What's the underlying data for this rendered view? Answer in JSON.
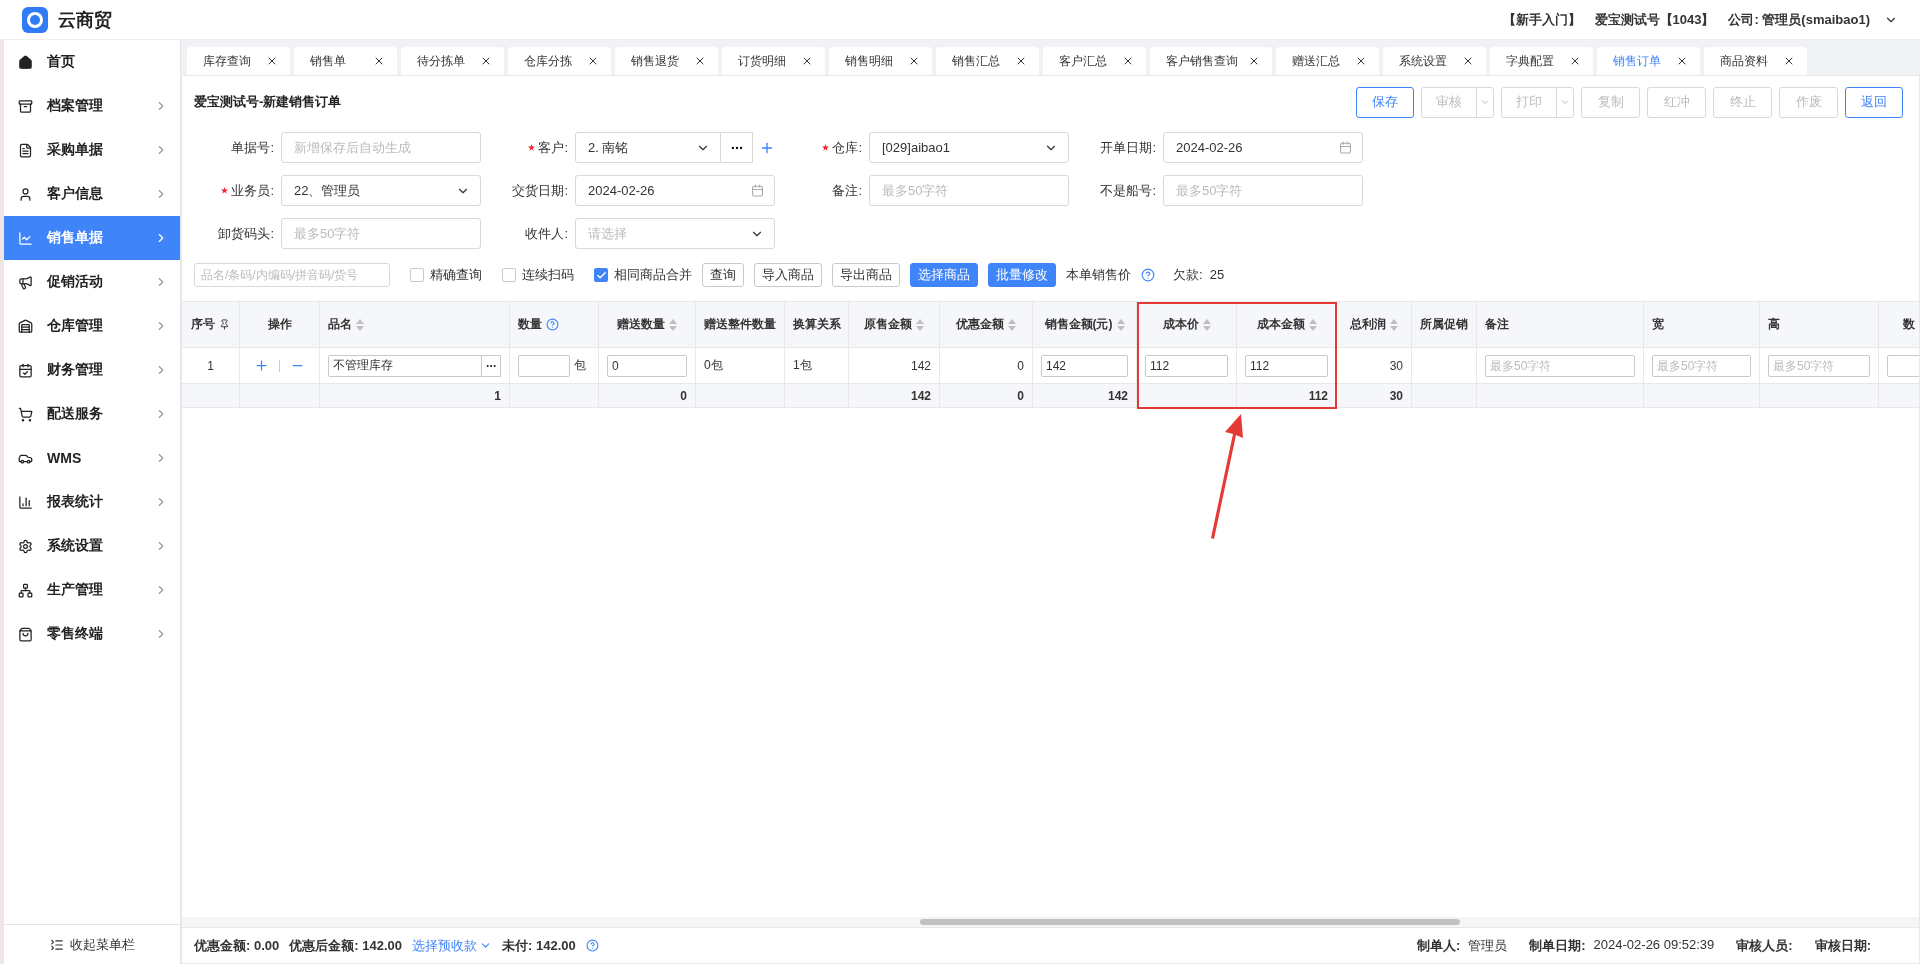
{
  "header": {
    "app_name": "云商贸",
    "links": [
      "【新手入门】",
      "爱宝测试号【1043】"
    ],
    "account": "公司: 管理员(smaibao1)"
  },
  "sidebar": {
    "items": [
      {
        "label": "首页",
        "selected": false,
        "expandable": false
      },
      {
        "label": "档案管理",
        "selected": false,
        "expandable": true
      },
      {
        "label": "采购单据",
        "selected": false,
        "expandable": true
      },
      {
        "label": "客户信息",
        "selected": false,
        "expandable": true
      },
      {
        "label": "销售单据",
        "selected": true,
        "expandable": true
      },
      {
        "label": "促销活动",
        "selected": false,
        "expandable": true
      },
      {
        "label": "仓库管理",
        "selected": false,
        "expandable": true
      },
      {
        "label": "财务管理",
        "selected": false,
        "expandable": true
      },
      {
        "label": "配送服务",
        "selected": false,
        "expandable": true
      },
      {
        "label": "WMS",
        "selected": false,
        "expandable": true
      },
      {
        "label": "报表统计",
        "selected": false,
        "expandable": true
      },
      {
        "label": "系统设置",
        "selected": false,
        "expandable": true
      },
      {
        "label": "生产管理",
        "selected": false,
        "expandable": true
      },
      {
        "label": "零售终端",
        "selected": false,
        "expandable": true
      }
    ],
    "collapse_label": "收起菜单栏"
  },
  "tabs": [
    {
      "label": "库存查询",
      "selected": false
    },
    {
      "label": "销售单",
      "selected": false
    },
    {
      "label": "待分拣单",
      "selected": false
    },
    {
      "label": "仓库分拣",
      "selected": false
    },
    {
      "label": "销售退货",
      "selected": false
    },
    {
      "label": "订货明细",
      "selected": false
    },
    {
      "label": "销售明细",
      "selected": false
    },
    {
      "label": "销售汇总",
      "selected": false
    },
    {
      "label": "客户汇总",
      "selected": false
    },
    {
      "label": "客户销售查询",
      "selected": false
    },
    {
      "label": "赠送汇总",
      "selected": false
    },
    {
      "label": "系统设置",
      "selected": false
    },
    {
      "label": "字典配置",
      "selected": false
    },
    {
      "label": "销售订单",
      "selected": true
    },
    {
      "label": "商品资料",
      "selected": false
    }
  ],
  "page_title": "爱宝测试号-新建销售订单",
  "actions": [
    {
      "label": "保存",
      "disabled": false,
      "dropdown": false
    },
    {
      "label": "审核",
      "disabled": true,
      "dropdown": true
    },
    {
      "label": "打印",
      "disabled": true,
      "dropdown": true
    },
    {
      "label": "复制",
      "disabled": true,
      "dropdown": false
    },
    {
      "label": "红冲",
      "disabled": true,
      "dropdown": false
    },
    {
      "label": "终止",
      "disabled": true,
      "dropdown": false
    },
    {
      "label": "作废",
      "disabled": true,
      "dropdown": false
    },
    {
      "label": "返回",
      "disabled": false,
      "dropdown": false
    }
  ],
  "form": [
    {
      "label": "单据号:",
      "required": false,
      "kind": "text",
      "placeholder": "新增保存后自动生成"
    },
    {
      "label": "客户:",
      "required": true,
      "kind": "customer",
      "value": "2. 南铭"
    },
    {
      "label": "仓库:",
      "required": true,
      "kind": "select",
      "value": "[029]aibao1"
    },
    {
      "label": "开单日期:",
      "required": false,
      "kind": "date",
      "value": "2024-02-26"
    },
    {
      "label": "业务员:",
      "required": true,
      "kind": "select",
      "value": "22、管理员"
    },
    {
      "label": "交货日期:",
      "required": false,
      "kind": "date",
      "value": "2024-02-26"
    },
    {
      "label": "备注:",
      "required": false,
      "kind": "text",
      "placeholder": "最多50字符"
    },
    {
      "label": "不是船号:",
      "required": false,
      "kind": "text",
      "placeholder": "最多50字符"
    },
    {
      "label": "卸货码头:",
      "required": false,
      "kind": "text",
      "placeholder": "最多50字符"
    },
    {
      "label": "收件人:",
      "required": false,
      "kind": "select",
      "placeholder": "请选择"
    }
  ],
  "toolbar": {
    "search": {
      "placeholder": "品名/条码/内编码/拼音码/货号"
    },
    "checkboxes": [
      {
        "label": "精确查询",
        "checked": false
      },
      {
        "label": "连续扫码",
        "checked": false
      },
      {
        "label": "相同商品合并",
        "checked": true
      }
    ],
    "buttons": [
      {
        "label": "查询",
        "kind": "default"
      },
      {
        "label": "导入商品",
        "kind": "default"
      },
      {
        "label": "导出商品",
        "kind": "default"
      },
      {
        "label": "选择商品",
        "kind": "primary"
      },
      {
        "label": "批量修改",
        "kind": "primary"
      }
    ],
    "price_label": "本单销售价",
    "debt": "欠款:  25"
  },
  "table": {
    "columns": [
      {
        "label": "序号",
        "sortable": false,
        "help": false,
        "highlighted": false
      },
      {
        "label": "操作",
        "sortable": false,
        "help": false,
        "highlighted": false
      },
      {
        "label": "品名",
        "sortable": true,
        "help": false,
        "highlighted": false,
        "total": "1"
      },
      {
        "label": "数量",
        "sortable": false,
        "help": true,
        "highlighted": false
      },
      {
        "label": "赠送数量",
        "sortable": true,
        "help": false,
        "highlighted": false,
        "total": "0"
      },
      {
        "label": "赠送整件数量",
        "sortable": false,
        "help": false,
        "highlighted": false
      },
      {
        "label": "换算关系",
        "sortable": false,
        "help": false,
        "highlighted": false
      },
      {
        "label": "原售金额",
        "sortable": true,
        "help": false,
        "highlighted": false,
        "total": "142"
      },
      {
        "label": "优惠金额",
        "sortable": true,
        "help": false,
        "highlighted": false,
        "total": "0"
      },
      {
        "label": "销售金额(元)",
        "sortable": true,
        "help": false,
        "highlighted": false,
        "total": "142"
      },
      {
        "label": "成本价",
        "sortable": true,
        "help": false,
        "highlighted": true
      },
      {
        "label": "成本金额",
        "sortable": true,
        "help": false,
        "highlighted": true,
        "total": "112"
      },
      {
        "label": "总利润",
        "sortable": true,
        "help": false,
        "highlighted": false,
        "total": "30"
      },
      {
        "label": "所属促销",
        "sortable": false,
        "help": false,
        "highlighted": false
      },
      {
        "label": "备注",
        "sortable": false,
        "help": false,
        "highlighted": false
      },
      {
        "label": "宽",
        "sortable": false,
        "help": false,
        "highlighted": false
      },
      {
        "label": "高",
        "sortable": false,
        "help": false,
        "highlighted": false
      },
      {
        "label": "数",
        "sortable": false,
        "help": false,
        "highlighted": false
      }
    ],
    "rows": [
      {
        "cells": [
          {
            "kind": "text",
            "text": "1"
          },
          {
            "kind": "actions"
          },
          {
            "kind": "picker",
            "value": "不管理库存"
          },
          {
            "kind": "input-unit",
            "unit": "包"
          },
          {
            "kind": "input",
            "value": "0"
          },
          {
            "kind": "text",
            "text": "0包"
          },
          {
            "kind": "text",
            "text": "1包"
          },
          {
            "kind": "text",
            "text": "142"
          },
          {
            "kind": "text",
            "text": "0"
          },
          {
            "kind": "input",
            "value": "142"
          },
          {
            "kind": "input",
            "value": "112"
          },
          {
            "kind": "input",
            "value": "112"
          },
          {
            "kind": "text",
            "text": "30"
          },
          {
            "kind": "empty"
          },
          {
            "kind": "input",
            "placeholder": "最多50字符"
          },
          {
            "kind": "input",
            "placeholder": "最多50字符"
          },
          {
            "kind": "input",
            "placeholder": "最多50字符"
          },
          {
            "kind": "input"
          }
        ]
      }
    ]
  },
  "footer": {
    "left": [
      {
        "label": "优惠金额:",
        "value": "0.00"
      },
      {
        "label": "优惠后金额:",
        "value": "142.00"
      }
    ],
    "link": "选择预收款",
    "unpaid": {
      "label": "未付:",
      "value": "142.00"
    },
    "right": [
      {
        "label": "制单人:",
        "value": "管理员"
      },
      {
        "label": "制单日期:",
        "value": "2024-02-26 09:52:39"
      },
      {
        "label": "审核人员:"
      },
      {
        "label": "审核日期:"
      }
    ]
  }
}
